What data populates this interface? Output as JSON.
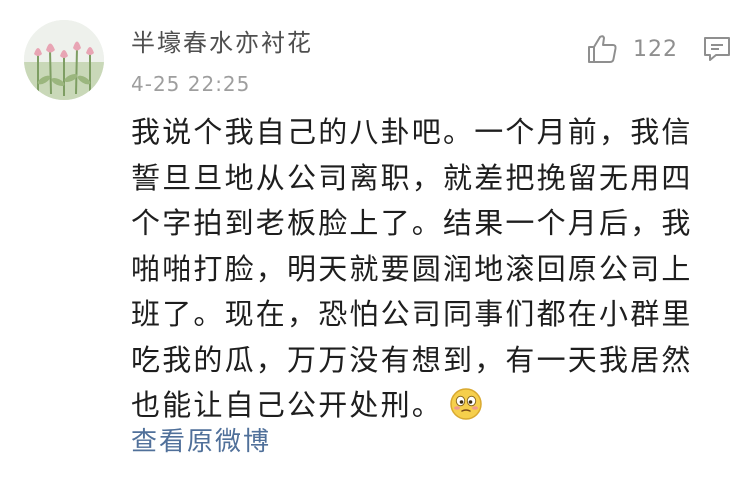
{
  "comment": {
    "username": "半壕春水亦衬花",
    "timestamp": "4-25 22:25",
    "likes": "122",
    "text": "我说个我自己的八卦吧。一个月前，我信誓旦旦地从公司离职，就差把挽留无用四个字拍到老板脸上了。结果一个月后，我啪啪打脸，明天就要圆润地滚回原公司上班了。现在，恐怕公司同事们都在小群里吃我的瓜，万万没有想到，有一天我居然也能让自己公开处刑。",
    "emoji": "embarrassed-face-emoji",
    "view_original_label": "查看原微博"
  },
  "icons": {
    "like": "thumbs-up-icon",
    "comment": "comment-bubble-icon",
    "avatar": "tulip-field-avatar"
  },
  "colors": {
    "username": "#4f4f4f",
    "timestamp": "#9e9e9e",
    "body_text": "#1e1e1e",
    "link": "#50709a",
    "icon": "#8f8f8f"
  }
}
